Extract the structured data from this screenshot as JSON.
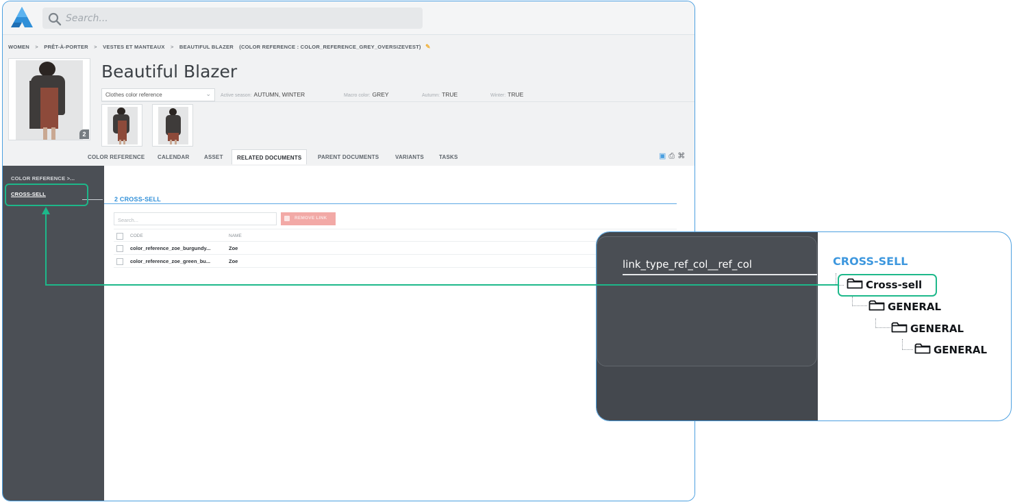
{
  "search": {
    "placeholder": "Search..."
  },
  "breadcrumb": {
    "items": [
      "WOMEN",
      "PRÊT-À-PORTER",
      "VESTES ET MANTEAUX",
      "BEAUTIFUL BLAZER"
    ],
    "separator": ">",
    "reference": "(COLOR REFERENCE : COLOR_REFERENCE_GREY_OVERSIZEVEST)"
  },
  "product": {
    "title": "Beautiful Blazer",
    "image_count": "2",
    "type_select": "Clothes color reference",
    "attributes": [
      {
        "label": "Active season:",
        "value": "AUTUMN, WINTER"
      },
      {
        "label": "Macro color:",
        "value": "GREY"
      },
      {
        "label": "Autumn:",
        "value": "TRUE"
      },
      {
        "label": "Winter:",
        "value": "TRUE"
      }
    ]
  },
  "tabs": [
    "COLOR REFERENCE",
    "CALENDAR",
    "ASSET",
    "RELATED DOCUMENTS",
    "PARENT DOCUMENTS",
    "VARIANTS",
    "TASKS"
  ],
  "active_tab": "RELATED DOCUMENTS",
  "sidebar": {
    "items": [
      "COLOR REFERENCE >...",
      "CROSS-SELL"
    ]
  },
  "section": {
    "title": "2 CROSS-SELL",
    "search_placeholder": "Search...",
    "remove_label": "REMOVE LINK",
    "columns": [
      "CODE",
      "NAME"
    ],
    "rows": [
      {
        "code": "color_reference_zoe_burgundy...",
        "name": "Zoe"
      },
      {
        "code": "color_reference_zoe_green_bu...",
        "name": "Zoe"
      }
    ]
  },
  "zoom": {
    "link_type": "link_type_ref_col__ref_col",
    "title": "CROSS-SELL",
    "tree": [
      "Cross-sell",
      "GENERAL",
      "GENERAL",
      "GENERAL"
    ]
  },
  "colors": {
    "accent": "#2f8fd8",
    "highlight": "#1db88a",
    "sidebar": "#4b4f55",
    "danger": "#f2a9a6"
  },
  "icons": [
    "logo-icon",
    "search-icon",
    "edit-icon",
    "chevron-down-icon",
    "folder-icon",
    "remove-icon"
  ]
}
